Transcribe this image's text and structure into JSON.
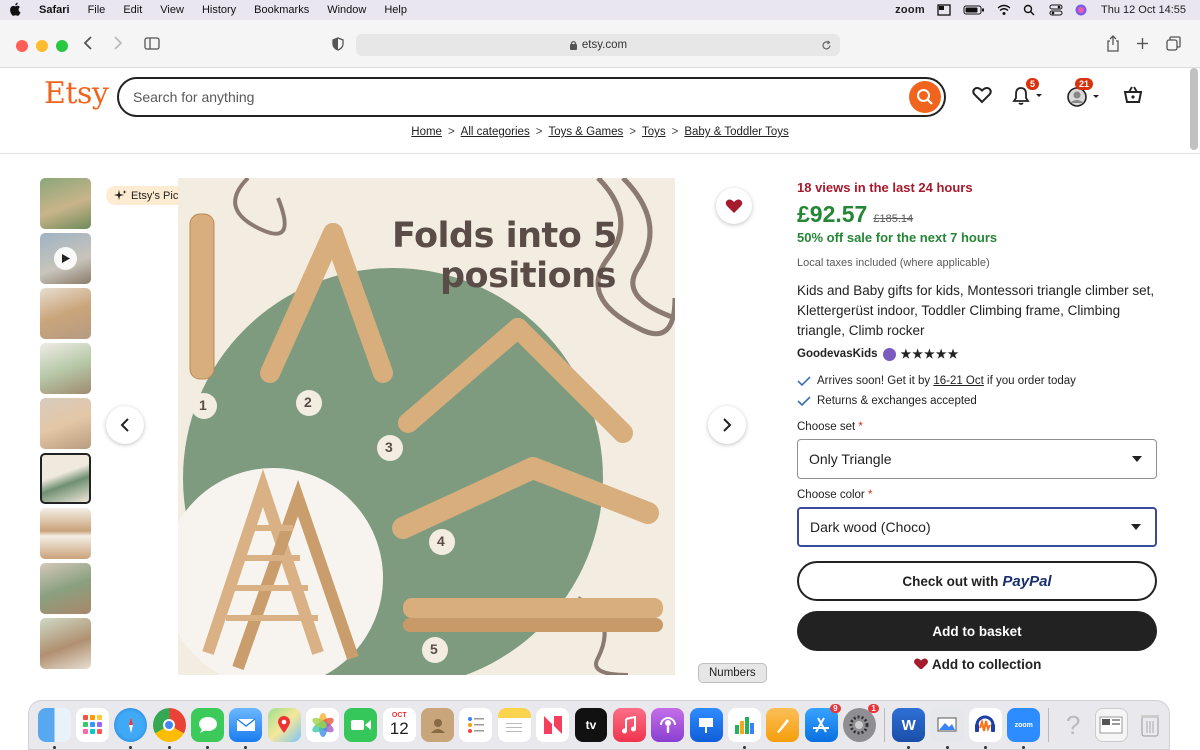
{
  "menubar": {
    "apple": "",
    "app": "Safari",
    "menus": [
      "File",
      "Edit",
      "View",
      "History",
      "Bookmarks",
      "Window",
      "Help"
    ],
    "zoom": "zoom",
    "datetime": "Thu 12 Oct  14:55"
  },
  "browser": {
    "url": "etsy.com"
  },
  "etsy": {
    "logo": "Etsy",
    "search_placeholder": "Search for anything",
    "notifications_count": "5",
    "account_count": "21",
    "breadcrumb": [
      "Home",
      "All categories",
      "Toys & Games",
      "Toys",
      "Baby & Toddler Toys"
    ]
  },
  "gallery": {
    "pick_label": "Etsy's Pick",
    "image_heading_1": "Folds into 5",
    "image_heading_2": "positions",
    "positions": [
      "1",
      "2",
      "3",
      "4",
      "5"
    ]
  },
  "product": {
    "views": "18 views in the last 24 hours",
    "price": "£92.57",
    "old_price": "£185.14",
    "sale": "50% off sale for the next 7 hours",
    "taxes": "Local taxes included (where applicable)",
    "title": "Kids and Baby gifts for kids, Montessori triangle climber set, Klettergerüst indoor, Toddler Climbing frame, Climbing triangle, Climb rocker",
    "shop": "GoodevasKids",
    "stars": "★★★★★",
    "perk_arrives_prefix": "Arrives soon! Get it by ",
    "perk_arrives_date": "16-21 Oct",
    "perk_arrives_suffix": " if you order today",
    "perk_returns": "Returns & exchanges accepted",
    "set_label": "Choose set",
    "set_value": "Only Triangle",
    "color_label": "Choose color",
    "color_value": "Dark wood (Choco)",
    "required_mark": "*",
    "checkout_label": "Check out with",
    "paypal": "PayPal",
    "basket_label": "Add to basket",
    "collection_label": "Add to collection"
  },
  "tooltip": "Numbers",
  "dock": {
    "calendar_month": "OCT",
    "calendar_day": "12",
    "mail_badge": "",
    "appstore_badge": "9",
    "settings_badge": "1",
    "tv_label": "tv",
    "word_label": "W",
    "zoom_label": "zoom"
  },
  "colors": {
    "etsy_orange": "#f1641e",
    "sale_green": "#258635",
    "views_red": "#a61a2e"
  }
}
